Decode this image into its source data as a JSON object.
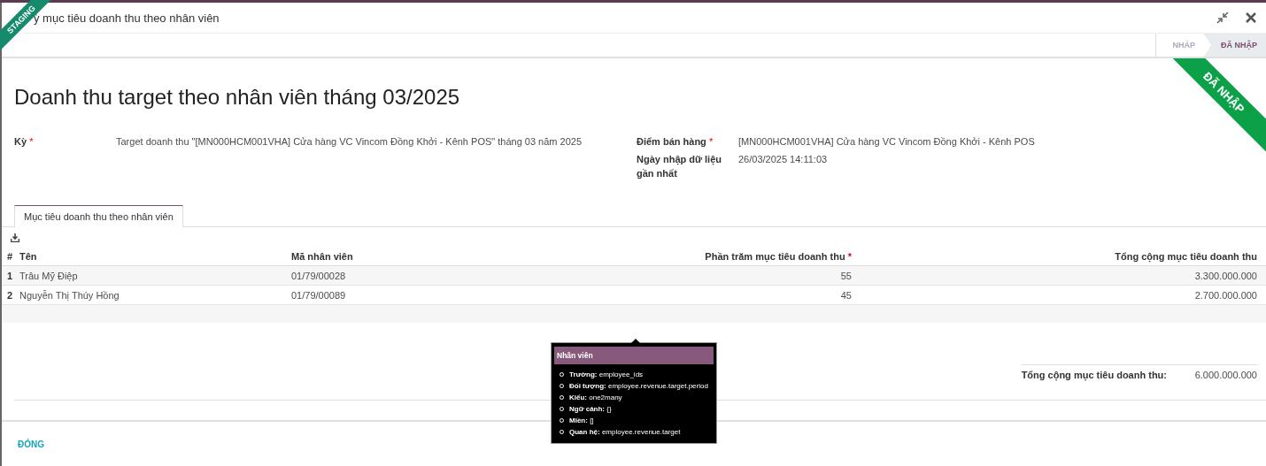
{
  "ribbon_env": "STAGING",
  "window": {
    "title": "ỳ mục tiêu doanh thu theo nhân viên"
  },
  "statusbar": {
    "stages": [
      {
        "label": "NHÁP",
        "selected": false
      },
      {
        "label": "ĐÃ NHẬP",
        "selected": true
      }
    ]
  },
  "ribbon_state": "ĐÃ NHẬP",
  "form": {
    "title": "Doanh thu target theo nhân viên tháng 03/2025",
    "left_fields": [
      {
        "label": "Kỳ",
        "required_mark": "*",
        "value": "Target doanh thu \"[MN000HCM001VHA] Cửa hàng VC Vincom Đồng Khởi - Kênh POS\" tháng 03 năm 2025"
      }
    ],
    "right_fields": [
      {
        "label": "Điểm bán hàng",
        "required_mark": "*",
        "value": "[MN000HCM001VHA] Cửa hàng VC Vincom Đồng Khởi - Kênh POS"
      },
      {
        "label": "Ngày nhập dữ liệu gần nhất",
        "value": "26/03/2025 14:11:03"
      }
    ]
  },
  "tabs": [
    {
      "label": "Mục tiêu doanh thu theo nhân viên",
      "selected": true
    }
  ],
  "table": {
    "columns": [
      {
        "label": "#"
      },
      {
        "label": "Tên"
      },
      {
        "label": "Mã nhân viên"
      },
      {
        "label": "Phần trăm mục tiêu doanh thu",
        "required_mark": "*"
      },
      {
        "label": "Tổng cộng mục tiêu doanh thu"
      }
    ],
    "rows": [
      [
        "1",
        "Trâu Mỹ Điệp",
        "01/79/00028",
        "55",
        "3.300.000.000"
      ],
      [
        "2",
        "Nguyễn Thị Thúy Hồng",
        "01/79/00089",
        "45",
        "2.700.000.000"
      ]
    ]
  },
  "total": {
    "label": "Tổng cộng mục tiêu doanh thu:",
    "value": "6.000.000.000"
  },
  "tooltip": {
    "title": "Nhân viên",
    "items": [
      {
        "label": "Trường:",
        "value": "employee_ids"
      },
      {
        "label": "Đối tượng:",
        "value": "employee.revenue.target.period"
      },
      {
        "label": "Kiểu:",
        "value": "one2many"
      },
      {
        "label": "Ngữ cảnh:",
        "value": "{}"
      },
      {
        "label": "Miền:",
        "value": "[]"
      },
      {
        "label": "Quan hệ:",
        "value": "employee.revenue.target"
      }
    ]
  },
  "footer": {
    "buttons": [
      "ĐÓNG"
    ]
  }
}
